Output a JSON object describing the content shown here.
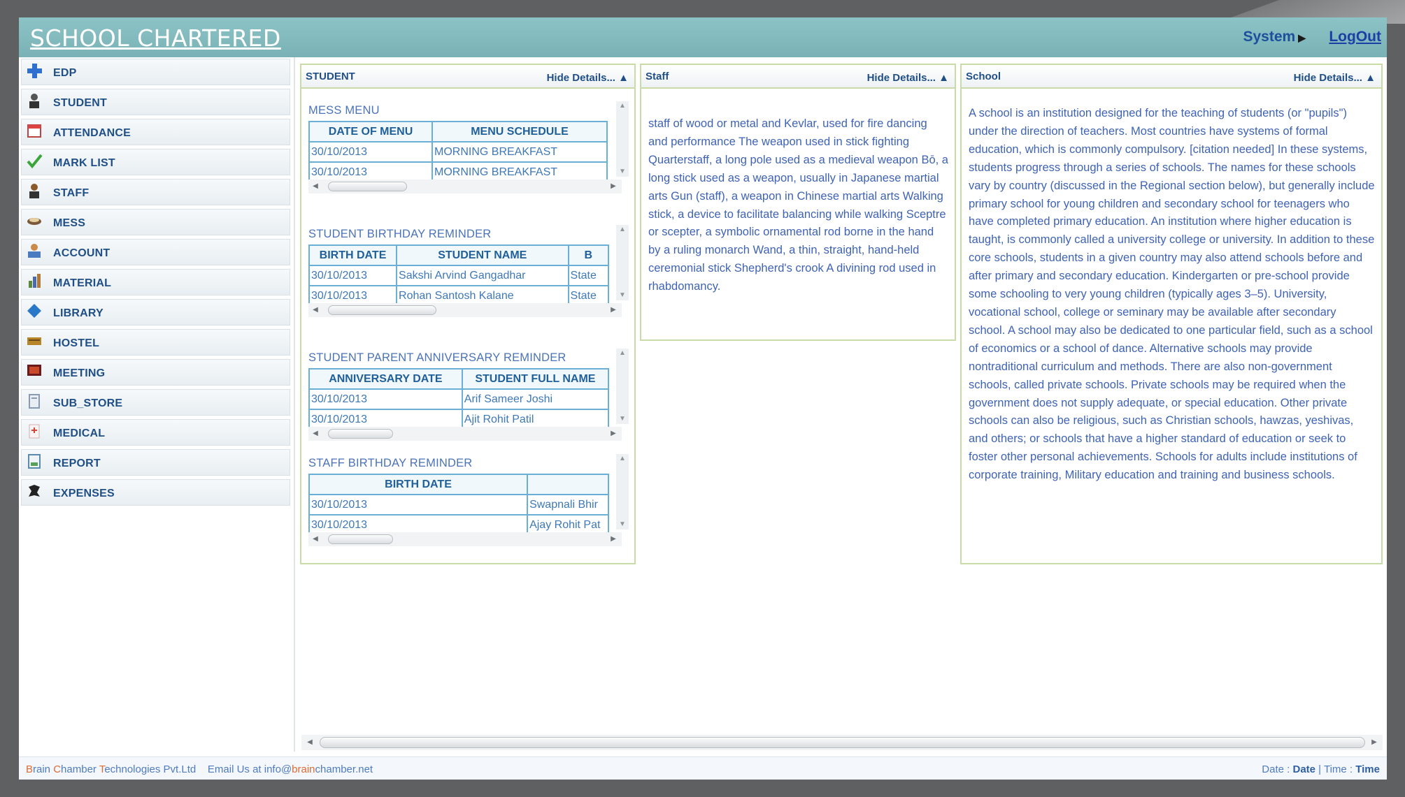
{
  "header": {
    "app_title": "SCHOOL CHARTERED",
    "system_label": "System",
    "logout_label": "LogOut"
  },
  "sidebar": {
    "items": [
      {
        "label": "EDP",
        "icon": "plus-icon"
      },
      {
        "label": "STUDENT",
        "icon": "student-icon"
      },
      {
        "label": "ATTENDANCE",
        "icon": "calendar-icon"
      },
      {
        "label": "MARK LIST",
        "icon": "checkmark-icon"
      },
      {
        "label": "STAFF",
        "icon": "staff-icon"
      },
      {
        "label": "MESS",
        "icon": "food-icon"
      },
      {
        "label": "ACCOUNT",
        "icon": "account-icon"
      },
      {
        "label": "MATERIAL",
        "icon": "material-icon"
      },
      {
        "label": "LIBRARY",
        "icon": "book-icon"
      },
      {
        "label": "HOSTEL",
        "icon": "hostel-icon"
      },
      {
        "label": "MEETING",
        "icon": "meeting-icon"
      },
      {
        "label": "SUB_STORE",
        "icon": "store-icon"
      },
      {
        "label": "MEDICAL",
        "icon": "medical-icon"
      },
      {
        "label": "REPORT",
        "icon": "report-icon"
      },
      {
        "label": "EXPENSES",
        "icon": "expenses-icon"
      }
    ]
  },
  "panels": {
    "student": {
      "title": "STUDENT",
      "hide_label": "Hide Details...",
      "mess_menu": {
        "title": "MESS MENU",
        "columns": [
          "DATE OF MENU",
          "MENU SCHEDULE"
        ],
        "rows": [
          [
            "30/10/2013",
            "MORNING BREAKFAST"
          ],
          [
            "30/10/2013",
            "MORNING BREAKFAST"
          ]
        ]
      },
      "student_birthday": {
        "title": "STUDENT BIRTHDAY REMINDER",
        "columns": [
          "BIRTH DATE",
          "STUDENT NAME",
          "B"
        ],
        "rows": [
          [
            "30/10/2013",
            "Sakshi Arvind Gangadhar",
            "State"
          ],
          [
            "30/10/2013",
            "Rohan Santosh Kalane",
            "State"
          ]
        ]
      },
      "parent_anniversary": {
        "title": "STUDENT PARENT ANNIVERSARY REMINDER",
        "columns": [
          "ANNIVERSARY DATE",
          "STUDENT FULL NAME"
        ],
        "rows": [
          [
            "30/10/2013",
            "Arif Sameer Joshi"
          ],
          [
            "30/10/2013",
            "Ajit Rohit Patil"
          ]
        ]
      },
      "staff_birthday": {
        "title": "STAFF BIRTHDAY REMINDER",
        "columns": [
          "BIRTH DATE",
          ""
        ],
        "rows": [
          [
            "30/10/2013",
            "Swapnali Bhir"
          ],
          [
            "30/10/2013",
            "Ajay Rohit Pat"
          ]
        ]
      }
    },
    "staff": {
      "title": "Staff",
      "hide_label": "Hide Details...",
      "text": "staff of wood or metal and Kevlar, used for fire dancing and performance The weapon used in stick fighting Quarterstaff, a long pole used as a medieval weapon Bō, a long stick used as a weapon, usually in Japanese martial arts Gun (staff), a weapon in Chinese martial arts Walking stick, a device to facilitate balancing while walking Sceptre or scepter, a symbolic ornamental rod borne in the hand by a ruling monarch Wand, a thin, straight, hand-held ceremonial stick Shepherd's crook A divining rod used in rhabdomancy."
    },
    "school": {
      "title": "School",
      "hide_label": "Hide Details...",
      "text": "A school is an institution designed for the teaching of students (or \"pupils\") under the direction of teachers. Most countries have systems of formal education, which is commonly compulsory. [citation needed] In these systems, students progress through a series of schools. The names for these schools vary by country (discussed in the Regional section below), but generally include primary school for young children and secondary school for teenagers who have completed primary education. An institution where higher education is taught, is commonly called a university college or university. In addition to these core schools, students in a given country may also attend schools before and after primary and secondary education. Kindergarten or pre-school provide some schooling to very young children (typically ages 3–5). University, vocational school, college or seminary may be available after secondary school. A school may also be dedicated to one particular field, such as a school of economics or a school of dance. Alternative schools may provide nontraditional curriculum and methods. There are also non-government schools, called private schools. Private schools may be required when the government does not supply adequate, or special education. Other private schools can also be religious, such as Christian schools, hawzas, yeshivas, and others; or schools that have a higher standard of education or seek to foster other personal achievements. Schools for adults include institutions of corporate training, Military education and training and business schools."
    }
  },
  "footer": {
    "company_b": "B",
    "company_rain": "rain ",
    "company_c": "C",
    "company_hamber": "hamber ",
    "company_t": "T",
    "company_rest": "echnologies Pvt.Ltd",
    "email_prefix": "Email Us at info@",
    "email_hl": "brain",
    "email_suffix": "chamber.net",
    "date_label": "Date : ",
    "date_value": "Date",
    "sep": " | ",
    "time_label": "Time : ",
    "time_value": "Time"
  },
  "colors": {
    "header_bg": "#82bbbf",
    "link_blue": "#1f4f86",
    "panel_border": "#c9dba6",
    "grid_border": "#6ab0d6",
    "footer_accent": "#e06a32"
  }
}
